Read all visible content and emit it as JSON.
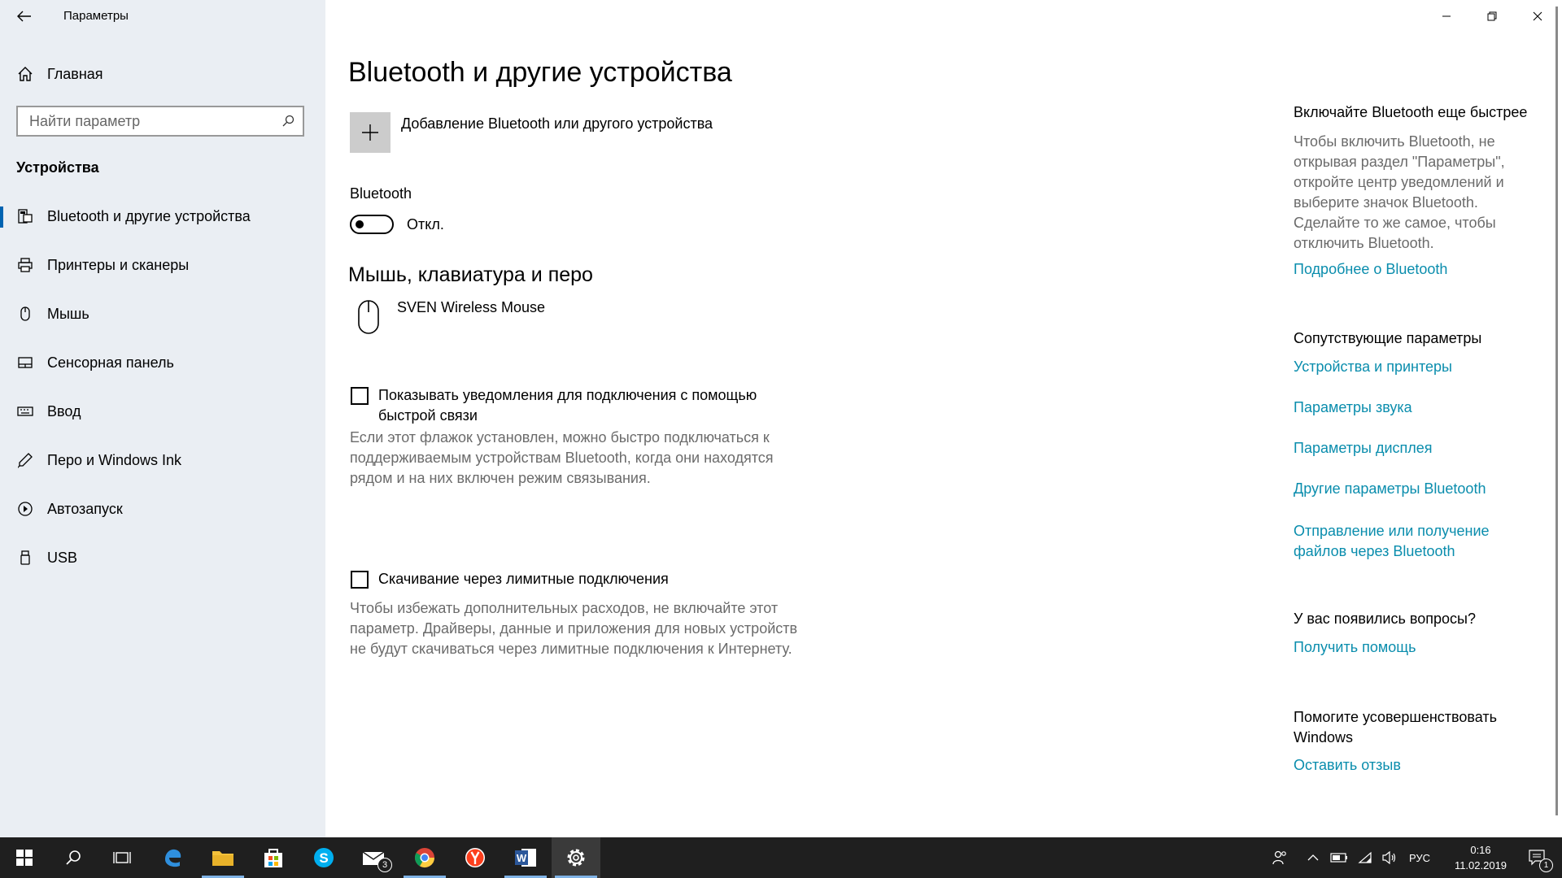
{
  "window": {
    "title": "Параметры"
  },
  "sidebar": {
    "home_label": "Главная",
    "search_placeholder": "Найти параметр",
    "section_title": "Устройства",
    "items": [
      {
        "label": "Bluetooth и другие устройства",
        "icon": "bluetooth-devices-icon",
        "active": true
      },
      {
        "label": "Принтеры и сканеры",
        "icon": "printer-icon"
      },
      {
        "label": "Мышь",
        "icon": "mouse-icon"
      },
      {
        "label": "Сенсорная панель",
        "icon": "touchpad-icon"
      },
      {
        "label": "Ввод",
        "icon": "keyboard-icon"
      },
      {
        "label": "Перо и Windows Ink",
        "icon": "pen-icon"
      },
      {
        "label": "Автозапуск",
        "icon": "autoplay-icon"
      },
      {
        "label": "USB",
        "icon": "usb-icon"
      }
    ]
  },
  "main": {
    "title": "Bluetooth и другие устройства",
    "add_device_label": "Добавление Bluetooth или другого устройства",
    "bluetooth_label": "Bluetooth",
    "bluetooth_state": "Откл.",
    "bluetooth_on": false,
    "mouse_section_title": "Мышь, клавиатура и перо",
    "device_name": "SVEN Wireless Mouse",
    "swift_pair": {
      "label": "Показывать уведомления для подключения с помощью быстрой связи",
      "checked": false,
      "description": "Если этот флажок установлен, можно быстро подключаться к поддерживаемым устройствам Bluetooth, когда они находятся рядом и на них включен режим связывания."
    },
    "metered": {
      "label": "Скачивание через лимитные подключения",
      "checked": false,
      "description": "Чтобы избежать дополнительных расходов, не включайте этот параметр. Драйверы, данные и приложения для новых устройств не будут скачиваться через лимитные подключения к Интернету."
    }
  },
  "right": {
    "quick_title": "Включайте Bluetooth еще быстрее",
    "quick_text": "Чтобы включить Bluetooth, не открывая раздел \"Параметры\", откройте центр уведомлений и выберите значок Bluetooth. Сделайте то же самое, чтобы отключить Bluetooth.",
    "quick_link": "Подробнее о Bluetooth",
    "related_title": "Сопутствующие параметры",
    "related_links": [
      "Устройства и принтеры",
      "Параметры звука",
      "Параметры дисплея",
      "Другие параметры Bluetooth",
      "Отправление или получение файлов через Bluetooth"
    ],
    "questions_title": "У вас появились вопросы?",
    "help_link": "Получить помощь",
    "improve_title": "Помогите усовершенствовать Windows",
    "feedback_link": "Оставить отзыв"
  },
  "taskbar": {
    "mail_badge": "3",
    "language": "РУС",
    "time": "0:16",
    "date": "11.02.2019",
    "notification_count": "1"
  },
  "colors": {
    "link": "#0a8dad",
    "accent": "#0063b1",
    "sidebar_bg": "#eaeef3",
    "taskbar_bg": "#1f1f1f"
  }
}
